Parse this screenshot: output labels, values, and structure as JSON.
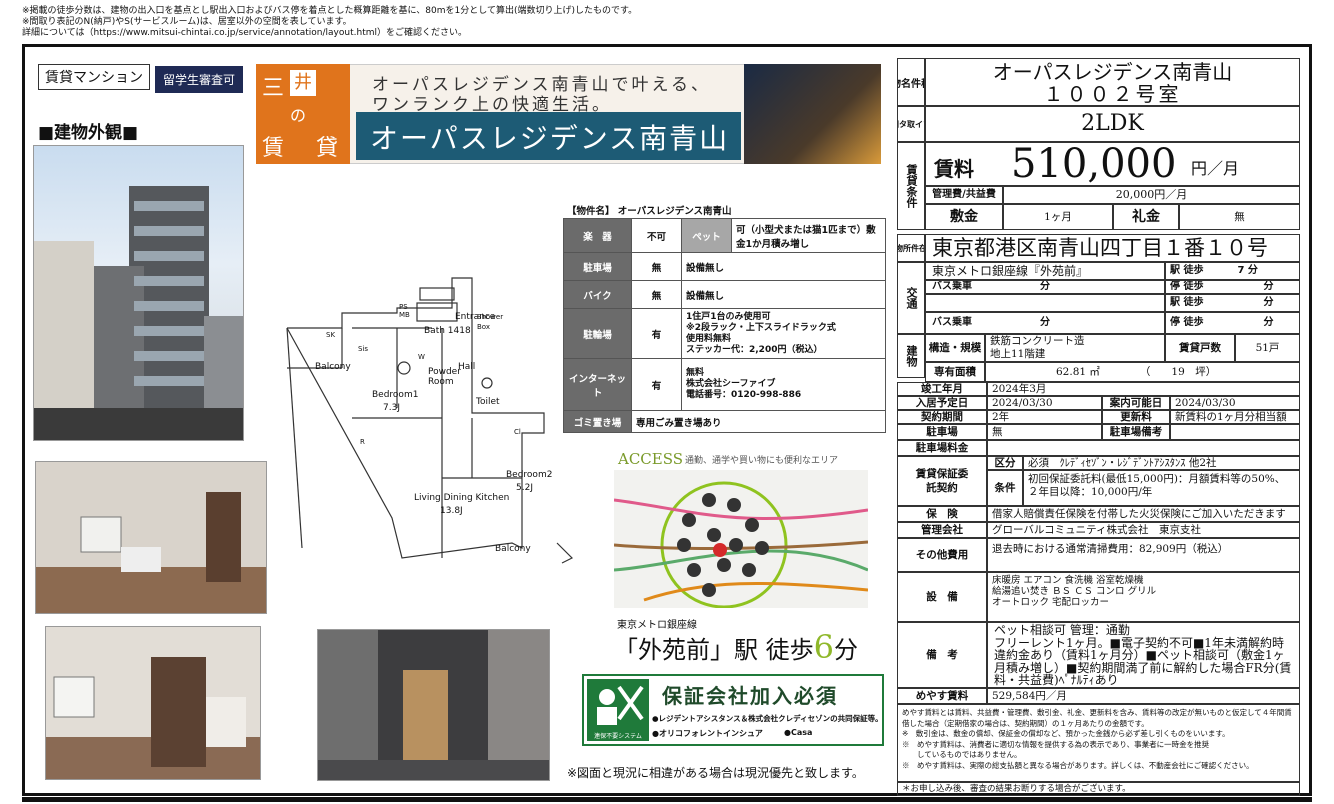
{
  "notes": [
    "※掲載の徒歩分数は、建物の出入口を基点とし駅出入口およびバス停を着点とした概算距離を基に、80mを1分として算出(端数切り上げ)したものです。",
    "※間取り表記のN(納戸)やS(サービスルーム)は、居室以外の空間を表しています。",
    "詳細については（https://www.mitsui-chintai.co.jp/service/annotation/layout.html）をご確認ください。"
  ],
  "tags": {
    "type": "賃貸マンション",
    "student": "留学生審査可"
  },
  "exterior_title": "■建物外観■",
  "banner": {
    "logo": [
      "三",
      "井",
      "の",
      "賃",
      "貸"
    ],
    "catch1": "オーパスレジデンス南青山で叶える、",
    "catch2": "ワンランク上の快適生活。",
    "name": "オーパスレジデンス南青山"
  },
  "facility": {
    "title": "【物件名】 オーパスレジデンス南青山",
    "rows": [
      {
        "k": "楽　器",
        "v": "不可",
        "k2": "ペット",
        "v2": "可（小型犬または猫1匹まで）敷金1か月積み増し"
      },
      {
        "k": "駐車場",
        "v": "無",
        "note": "設備無し"
      },
      {
        "k": "バイク",
        "v": "無",
        "note": "設備無し"
      },
      {
        "k": "駐輪場",
        "v": "有",
        "note": "1住戸1台のみ使用可\n※2段ラック・上下スライドラック式\n使用料無料\nステッカー代：2,200円（税込）"
      },
      {
        "k": "インターネット",
        "v": "有",
        "note": "無料\n株式会社シーファイブ\n電話番号：0120-998-886"
      },
      {
        "k": "ゴミ置き場",
        "note": "専用ごみ置き場あり"
      }
    ]
  },
  "floorplan": {
    "bath": "Bath 1418",
    "entrance": "Entrance",
    "hall": "Hall",
    "toilet": "Toilet",
    "powder": "Powder Room",
    "shower": "Shower Box",
    "balcony1": "Balcony",
    "balcony2": "Balcony",
    "bed1": "Bedroom1",
    "bed1s": "7.3J",
    "bed2": "Bedroom2",
    "bed2s": "5.2J",
    "ldk": "Living Dining Kitchen",
    "ldks": "13.8J",
    "sk": "SK",
    "ps": "PS MB",
    "w": "W",
    "r": "R",
    "cl": "Cl",
    "sis": "Sis"
  },
  "access": {
    "title": "ACCESS",
    "sub": "通勤、通学や買い物にも便利なエリア",
    "line": "東京メトロ銀座線",
    "station": "「外苑前」駅 徒歩",
    "min": "6",
    "unit": "分"
  },
  "guarantee": {
    "title": "保証会社加入必須",
    "l1": "●レジデントアシスタンス＆株式会社クレディセゾンの共同保証等。",
    "l2": "●オリコフォレントインシュア",
    "l3": "●Casa",
    "logo": "連保不要システム"
  },
  "disclaimer": "※図面と現況に相違がある場合は現況優先と致します。",
  "right": {
    "name_lab": "物名件称",
    "name1": "オーパスレジデンス南青山",
    "name2": "１００２号室",
    "type_lab": "間タ取イプ",
    "type": "2LDK",
    "cond_lab": "賃貸条件",
    "rent_lab": "賃料",
    "rent": "510,000",
    "rent_unit": "円／月",
    "mgmt_lab": "管理費/共益費",
    "mgmt": "20,000円／月",
    "deposit_lab": "敷金",
    "deposit": "1ヶ月",
    "key_lab": "礼金",
    "key": "無",
    "addr_lab": "物所件在",
    "addr": "東京都港区南青山四丁目１番１０号",
    "traffic_lab": "交通",
    "t1": "東京メトロ銀座線『外苑前』",
    "t1b": "駅 徒歩",
    "t1m": "7 分",
    "bus": "バス乗車",
    "fun": "分",
    "stop": "停 徒歩",
    "eki": "駅 徒歩",
    "bldg_lab": "建物",
    "struct_lab": "構造・規模",
    "struct1": "鉄筋コンクリート造",
    "struct2": "地上11階建",
    "units_lab": "賃貸戸数",
    "units": "51戸",
    "area_lab": "専有面積",
    "area": "62.81 ㎡",
    "area2": "（　　19　坪）",
    "built_lab": "竣工年月",
    "built": "2024年3月",
    "move_lab": "入居予定日",
    "move": "2024/03/30",
    "view_lab": "案内可能日",
    "view": "2024/03/30",
    "term_lab": "契約期間",
    "term": "2年",
    "renew_lab": "更新料",
    "renew": "新賃料の1ヶ月分相当額",
    "park_lab": "駐車場",
    "park": "無",
    "park2_lab": "駐車場備考",
    "parkfee_lab": "駐車場料金",
    "guar_lab": "賃貸保証委託契約",
    "kubun": "区分",
    "kubun_v": "必須　ｸﾚﾃﾞｨｾｿﾞﾝ・ﾚｼﾞﾃﾞﾝﾄｱｼｽﾀﾝｽ 他2社",
    "jouken": "条件",
    "jouken_v": "初回保証委託料(最低15,000円)：月額賃料等の50%、２年目以降：10,000円/年",
    "ins_lab": "保　険",
    "ins": "借家人賠償責任保険を付帯した火災保険にご加入いただきます",
    "co_lab": "管理会社",
    "co": "グローバルコミュニティ株式会社　東京支社",
    "other_lab": "その他費用",
    "other": "退去時における通常清掃費用：82,909円（税込）",
    "eq_lab": "設　備",
    "eq": "床暖房 エアコン 食洗機 浴室乾燥機\n給湯追い焚き ＢＳ ＣＳ コンロ グリル\nオートロック 宅配ロッカー",
    "rem_lab": "備　考",
    "rem": "ペット相談可 管理：通勤\nフリーレント1ヶ月。■電子契約不可■1年未満解約時違約金あり（賃料1ヶ月分）■ペット相談可（敷金1ヶ月積み増し）■契約期間満了前に解約した場合FR分(賃料・共益費)ﾍﾟﾅﾙﾃｨあり",
    "meyasu_lab": "めやす賃料",
    "meyasu": "529,584円／月",
    "fine": "めやす賃料とは賃料、共益費・管理費、敷引金、礼金、更新料を含み、賃料等の改定が無いものと仮定して４年間賃借した場合（定期借家の場合は、契約期間）の１ヶ月あたりの金額です。\n※　敷引金は、敷金の償却、保証金の償却など、預かった金銭から必ず差し引くものをいいます。\n※　めやす賃料は、消費者に適切な情報を提供する為の表示であり、事業者に一時金を推奨\n　　しているものではありません。\n※　めやす賃料は、実際の総支払額と異なる場合があります。詳しくは、不動産会社にご確認ください。",
    "footer": "＊お申し込み後、審査の結果お断りする場合がございます。"
  }
}
